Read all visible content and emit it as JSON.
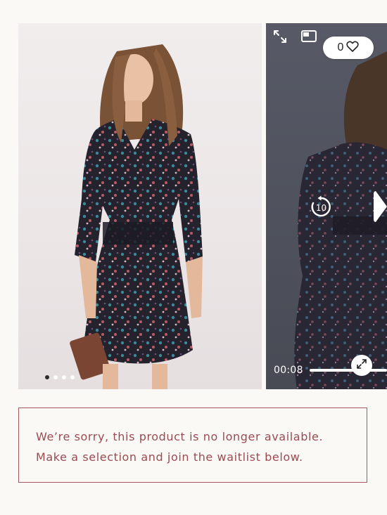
{
  "gallery": {
    "dots_count": 4,
    "active_dot": 0,
    "video": {
      "current_time": "00:08",
      "rewind_seconds": "10",
      "wishlist_count": "0"
    }
  },
  "notice": {
    "message": "We’re sorry, this product is no longer available. Make a selection and join the waitlist below."
  },
  "colors": {
    "notice_text": "#9a4b52",
    "notice_border": "#a1585e",
    "page_bg": "#fbf9f6",
    "video_bg": "#52555f"
  },
  "icons": [
    "expand-arrows-icon",
    "picture-in-picture-icon",
    "heart-icon",
    "rewind-10-icon",
    "play-icon",
    "fullscreen-icon"
  ]
}
